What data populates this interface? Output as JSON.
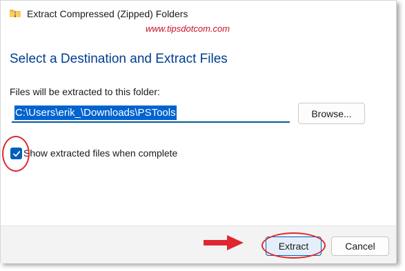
{
  "window": {
    "title": "Extract Compressed (Zipped) Folders",
    "watermark": "www.tipsdotcom.com",
    "icon": "zip-folder-icon"
  },
  "main": {
    "heading": "Select a Destination and Extract Files",
    "folder_label": "Files will be extracted to this folder:",
    "path_value": "C:\\Users\\erik_\\Downloads\\PSTools",
    "browse_label": "Browse...",
    "show_files_label": "Show extracted files when complete",
    "show_files_checked": true
  },
  "footer": {
    "extract_label": "Extract",
    "cancel_label": "Cancel"
  },
  "colors": {
    "heading": "#003d8f",
    "accent": "#005fb8",
    "annotation": "#e0272f",
    "watermark": "#c8102e"
  }
}
